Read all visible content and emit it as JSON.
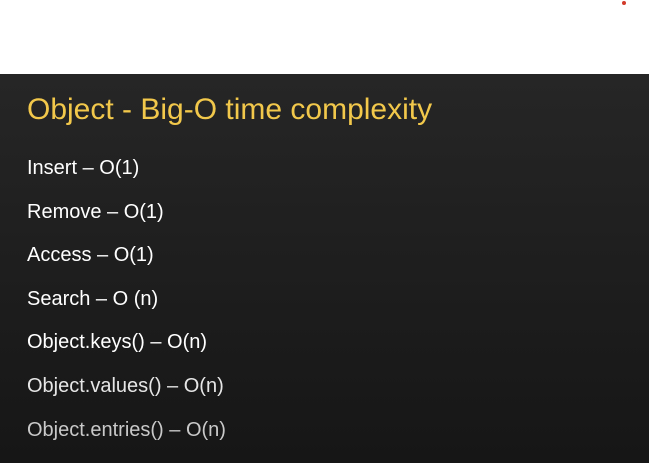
{
  "slide": {
    "title": "Object - Big-O time complexity",
    "bullets": [
      "Insert – O(1)",
      "Remove – O(1)",
      "Access – O(1)",
      "Search – O (n)",
      "Object.keys() – O(n)",
      "Object.values() – O(n)",
      "Object.entries() – O(n)"
    ]
  },
  "colors": {
    "title": "#f2c84b",
    "text": "#ffffff",
    "background_top": "#262626",
    "background_bottom": "#161616",
    "marker": "#d23a2a"
  }
}
